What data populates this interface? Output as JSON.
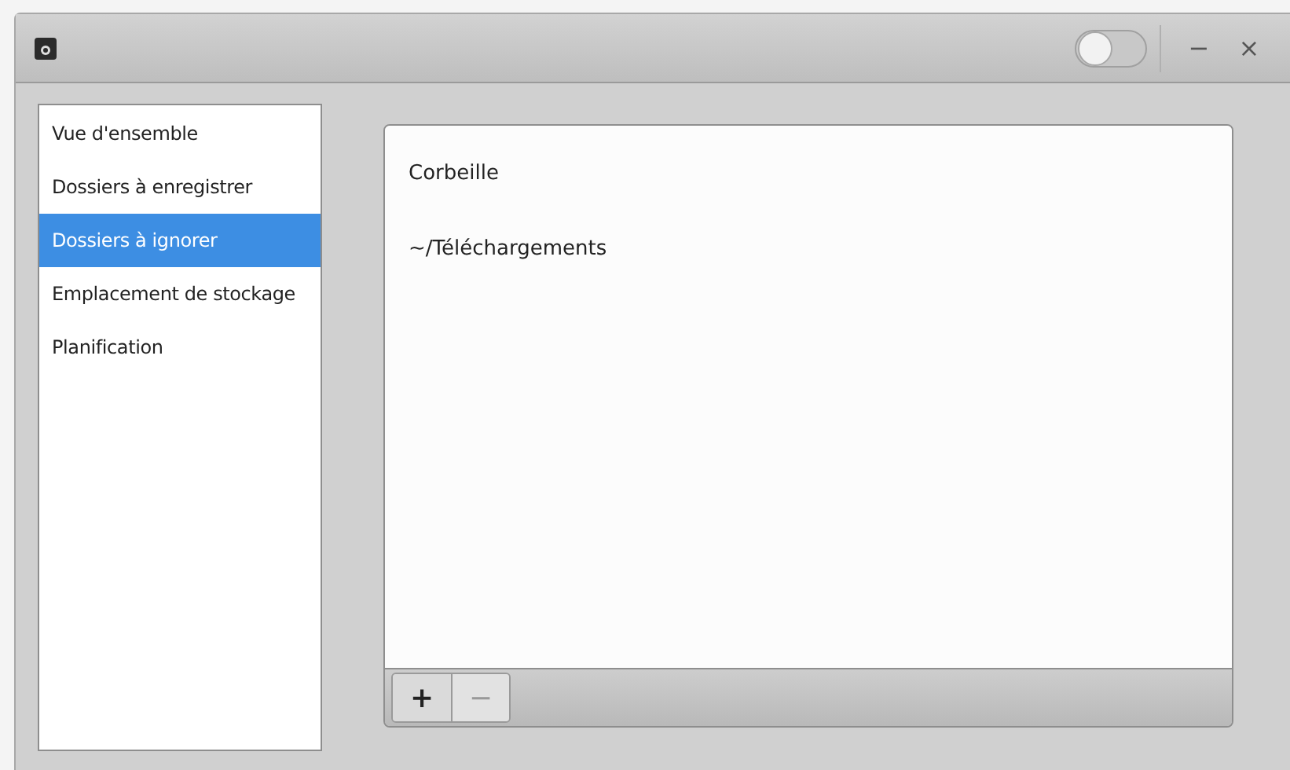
{
  "titlebar": {
    "toggle": {
      "on": false
    },
    "minimize": "−",
    "close": "×"
  },
  "sidebar": {
    "items": [
      {
        "label": "Vue d'ensemble",
        "selected": false
      },
      {
        "label": "Dossiers à enregistrer",
        "selected": false
      },
      {
        "label": "Dossiers à ignorer",
        "selected": true
      },
      {
        "label": "Emplacement de stockage",
        "selected": false
      },
      {
        "label": "Planification",
        "selected": false
      }
    ]
  },
  "folders": [
    {
      "label": "Corbeille"
    },
    {
      "label": "~/Téléchargements"
    }
  ],
  "toolbar": [
    {
      "label": "+",
      "disabled": false
    },
    {
      "label": "−",
      "disabled": true
    }
  ]
}
